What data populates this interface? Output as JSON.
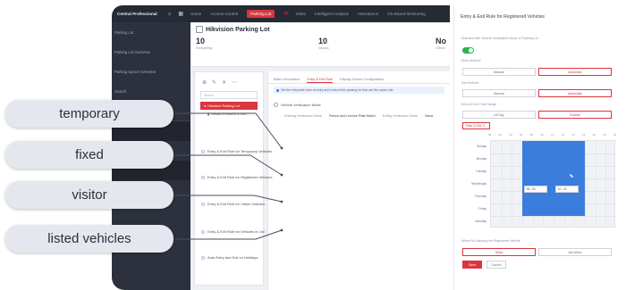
{
  "app": {
    "brand": "Central Professional",
    "nav": [
      "Home",
      "Access Control",
      "Parking Lot",
      "Video",
      "Intelligent Analysis",
      "Attendance",
      "On-Board Monitoring"
    ],
    "active_nav": "Parking Lot"
  },
  "sidebar": {
    "items": [
      "Parking Lot",
      "Parking Lot Overview",
      "Parking Space Overview",
      "Search",
      "Statistics and Reports",
      "",
      "Parking Guidance Configuration",
      "",
      "Parking Vist Mode"
    ]
  },
  "content": {
    "title": "Hikvision Parking Lot",
    "stats": [
      {
        "num": "10",
        "lbl": "Remaining"
      },
      {
        "num": "10",
        "lbl": "Vacant"
      },
      {
        "num": "No",
        "lbl": "Offline"
      }
    ]
  },
  "tree": {
    "search_placeholder": "Search",
    "root": "Hikvision Parking Lot",
    "child": "Default Entrance & Exit..."
  },
  "panel": {
    "tabs": [
      "Basic Information",
      "Entry & Exit Rule",
      "Display Screen Configuration"
    ],
    "active_tab": "Entry & Exit Rule",
    "notice": "Set the entry/exit rules at entry and exits of this parking lot that use the same rule.",
    "vehicle_verification": "Vehicle Verification Mode",
    "verification_label": "Entering Verification Mode",
    "verification_value": "Person and License Plate Match",
    "exit_verification_label": "Exiting Verification Mode",
    "exit_verification_value": "Same",
    "rules": [
      "Entry & Exit Rule for Temporary Vehicles",
      "Entry & Exit Rule for Registered Vehicles",
      "Entry & Exit Rule for Visitor Vehicles",
      "Entry & Exit Rule for Vehicles in List",
      "Auto Entry and Exit on Holidays"
    ]
  },
  "modal": {
    "title": "Entry & Exit Rule for Registered Vehicles",
    "match_label": "Matched with Vehicle Verification Mode of Parking Lot",
    "toggle_on": true,
    "entry_method_label": "Entry Method",
    "exit_method_label": "Exit Method",
    "manual": "Manual",
    "automatic": "Automatic",
    "time_range_label": "Entry & Exit Time Range",
    "all_day": "All Day",
    "custom": "Custom",
    "chip": "Entry & Exit Ti...",
    "hours": [
      "00",
      "02",
      "04",
      "06",
      "08",
      "10",
      "12",
      "14",
      "16",
      "18",
      "20",
      "22",
      "24"
    ],
    "days": [
      "Sunday",
      "Monday",
      "Tuesday",
      "Wednesday",
      "Thursday",
      "Friday",
      "Saturday"
    ],
    "time_start": "05 : 00",
    "time_end": "10 : 00",
    "vacancy_label": "When No Vacancy for Registered Vehicle",
    "allow": "Allow",
    "not_allow": "Not Allow",
    "save": "Save",
    "cancel": "Cancel"
  },
  "callouts": [
    "temporary",
    "fixed",
    "visitor",
    "listed vehicles"
  ],
  "colors": {
    "accent": "#d9363e",
    "schedule": "#3a7ddc",
    "toggle": "#2bb24c"
  }
}
